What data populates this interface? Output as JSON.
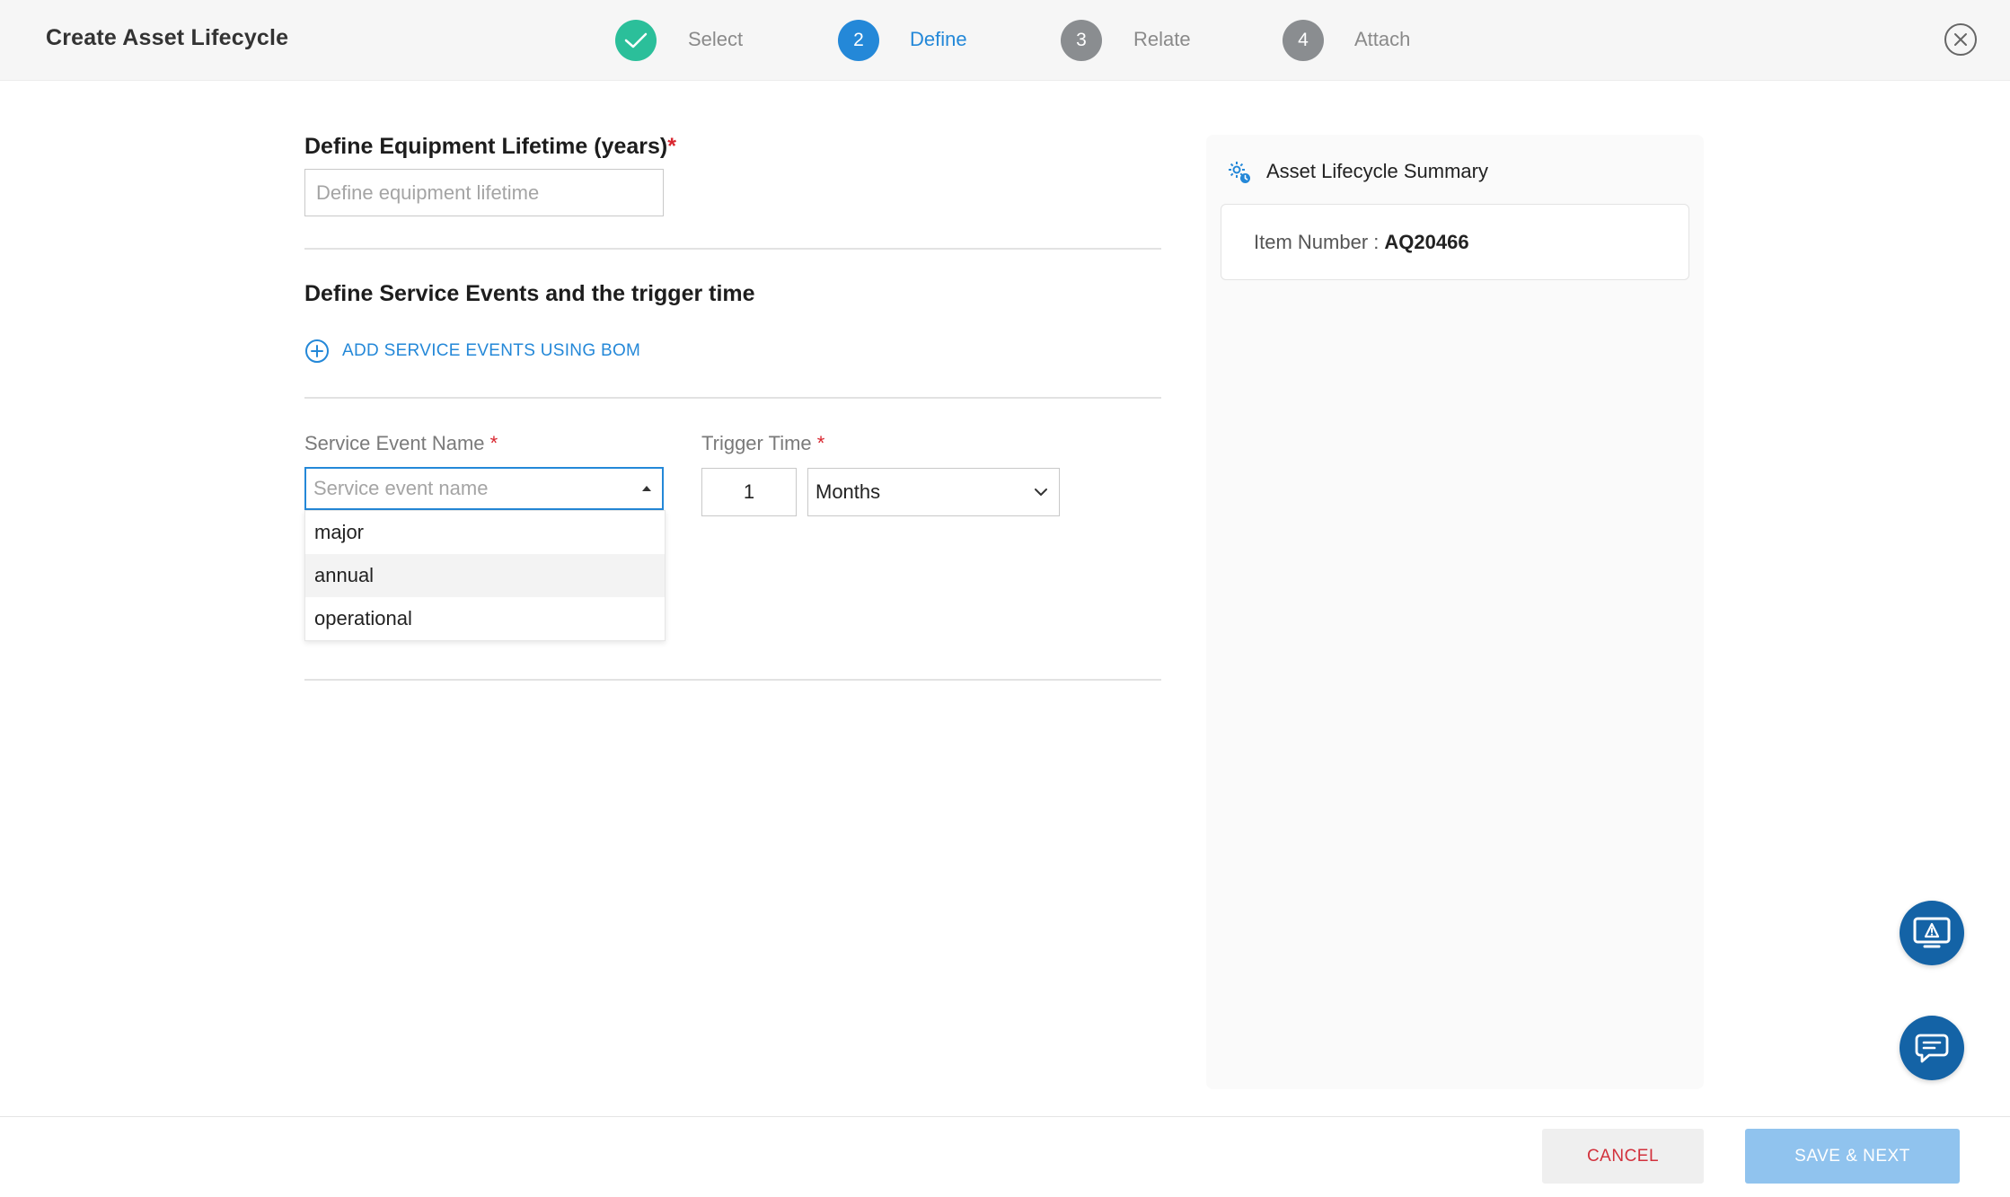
{
  "header": {
    "title": "Create Asset Lifecycle",
    "steps": [
      {
        "number": "",
        "label": "Select",
        "state": "completed",
        "icon": "check-icon"
      },
      {
        "number": "2",
        "label": "Define",
        "state": "active"
      },
      {
        "number": "3",
        "label": "Relate",
        "state": "pending"
      },
      {
        "number": "4",
        "label": "Attach",
        "state": "pending"
      }
    ],
    "close_icon": "close-icon"
  },
  "lifetime": {
    "title": "Define Equipment Lifetime (years)",
    "required_mark": "*",
    "placeholder": "Define equipment lifetime",
    "value": ""
  },
  "service_events": {
    "title": "Define Service Events and the trigger time",
    "add_link": "ADD SERVICE EVENTS USING BOM",
    "name_label": "Service Event Name",
    "name_required": "*",
    "name_placeholder": "Service event name",
    "options": [
      "major",
      "annual",
      "operational"
    ],
    "highlighted_option": "annual",
    "trigger_label": "Trigger Time",
    "trigger_required": "*",
    "trigger_value": "1",
    "trigger_unit": "Months"
  },
  "summary": {
    "title": "Asset Lifecycle Summary",
    "item_label": "Item Number :",
    "item_value": "AQ20466"
  },
  "footer": {
    "cancel_label": "CANCEL",
    "save_label": "SAVE & NEXT"
  },
  "colors": {
    "accent": "#2488d8",
    "success": "#2bbf9a",
    "pending": "#8a8d90",
    "danger": "#d9262f",
    "fab": "#1463a6",
    "save_disabled": "#90c3ee"
  }
}
